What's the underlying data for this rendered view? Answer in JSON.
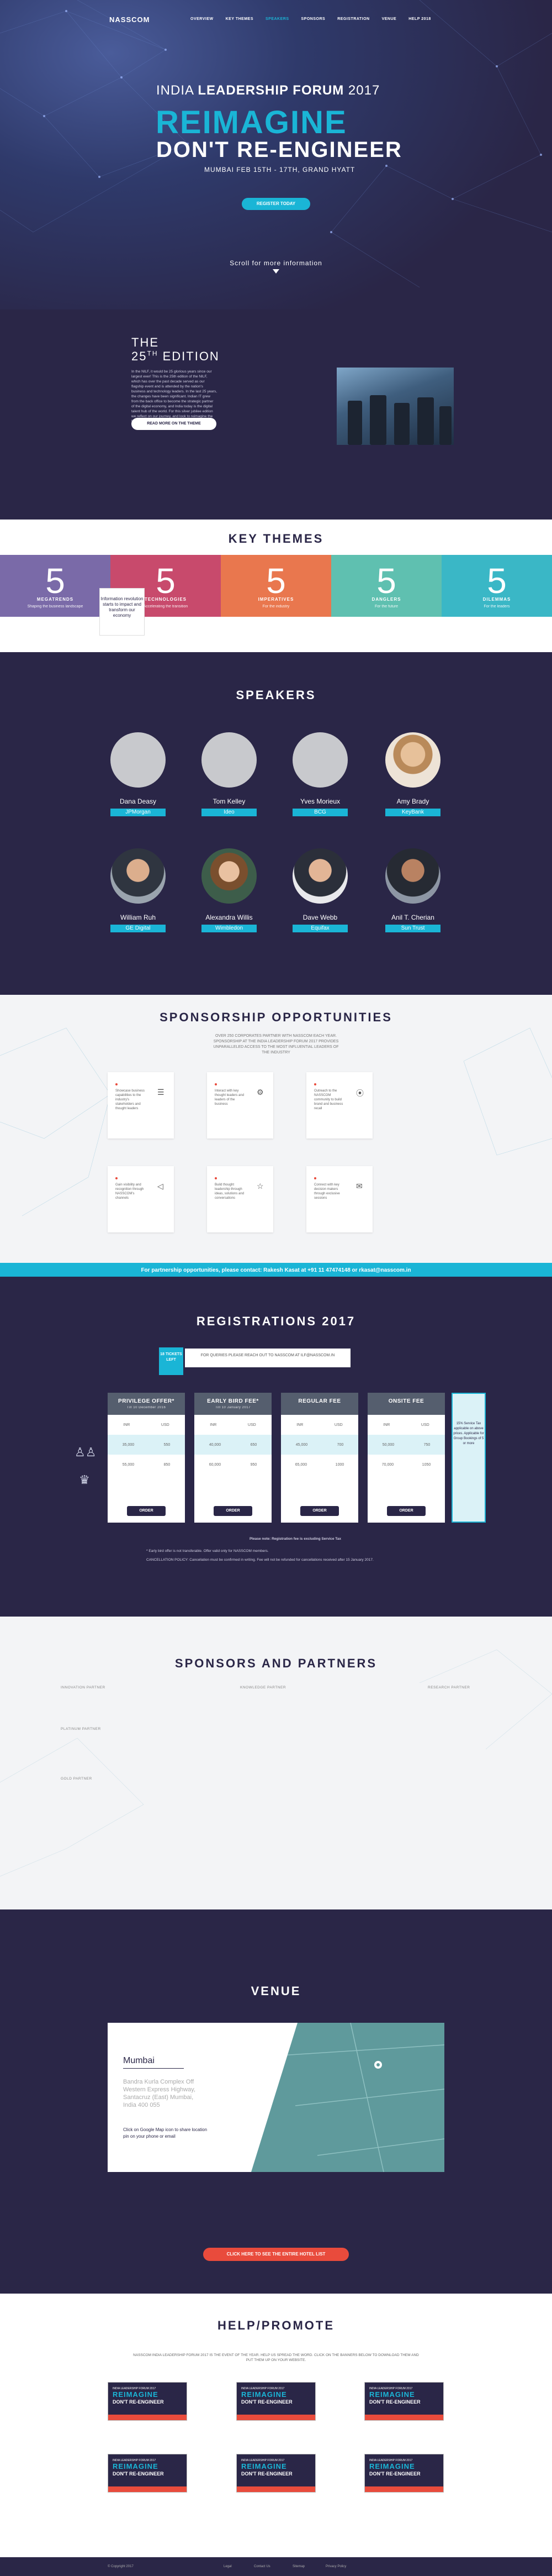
{
  "nav": {
    "logo": "NASSCOM",
    "items": [
      "OVERVIEW",
      "KEY THEMES",
      "SPEAKERS",
      "SPONSORS",
      "REGISTRATION",
      "VENUE",
      "HELP 2018"
    ]
  },
  "hero": {
    "forum_light": "INDIA ",
    "forum_bold": "LEADERSHIP FORUM",
    "forum_year": " 2017",
    "line1": "REIMAGINE",
    "line2": "DON'T RE-ENGINEER",
    "date": "MUMBAI FEB 15TH - 17TH, GRAND HYATT",
    "cta": "REGISTER TODAY",
    "scroll": "Scroll for more information"
  },
  "edition": {
    "the": "THE",
    "title": "25",
    "title_sup": "TH",
    "title_rest": " EDITION",
    "body": "In the NILF, it would be 25 glorious years since our largest ever! This is the 25th edition of the NILF, which has over the past decade served as our flagship event and is attended by the nation's business and technology leaders. In the last 25 years, the changes have been significant. Indian IT grew from the back office to become the strategic partner of the digital economy, and India today is the digital talent hub of the world. For this silver jubilee edition we reflect on our journey, and look to reimagine the future.",
    "cta": "READ MORE ON THE THEME"
  },
  "themes": {
    "title": "KEY THEMES",
    "items": [
      {
        "n": "5",
        "t": "MEGATRENDS",
        "s": "Shaping the business landscape",
        "color": "#7a6aa8"
      },
      {
        "n": "5",
        "t": "TECHNOLOGIES",
        "s": "Accelerating the transition",
        "color": "#c84a6c"
      },
      {
        "n": "5",
        "t": "IMPERATIVES",
        "s": "For the industry",
        "color": "#e9774e"
      },
      {
        "n": "5",
        "t": "DANGLERS",
        "s": "For the future",
        "color": "#5fc0b0"
      },
      {
        "n": "5",
        "t": "DILEMMAS",
        "s": "For the leaders",
        "color": "#3ab7c6"
      }
    ],
    "tooltip": "Information revolution starts to impact and transform our economy"
  },
  "speakers": {
    "title": "SPEAKERS",
    "items": [
      {
        "name": "Dana Deasy",
        "company": "JPMorgan",
        "photo": false
      },
      {
        "name": "Tom Kelley",
        "company": "Ideo",
        "photo": false
      },
      {
        "name": "Yves Morieux",
        "company": "BCG",
        "photo": false
      },
      {
        "name": "Amy Brady",
        "company": "KeyBank",
        "photo": true
      },
      {
        "name": "William Ruh",
        "company": "GE Digital",
        "photo": true
      },
      {
        "name": "Alexandra Willis",
        "company": "Wimbledon",
        "photo": true
      },
      {
        "name": "Dave Webb",
        "company": "Equifax",
        "photo": true
      },
      {
        "name": "Anil T. Cherian",
        "company": "Sun Trust",
        "photo": true
      }
    ]
  },
  "sponsorship": {
    "title": "SPONSORSHIP OPPORTUNITIES",
    "sub": "OVER 250 CORPORATES PARTNER WITH NASSCOM EACH YEAR. SPONSORSHIP AT THE INDIA LEADERSHIP FORUM 2017 PROVIDES UNPARALLELED ACCESS TO THE MOST INFLUENTIAL LEADERS OF THE INDUSTRY",
    "cards": [
      {
        "text": "Showcase business capabilities to the industry's stakeholders and thought leaders",
        "icon": "☰"
      },
      {
        "text": "Interact with key thought leaders and leaders of the business",
        "icon": "⚙"
      },
      {
        "text": "Outreach to the NASSCOM community to build brand and business recall",
        "icon": "⦿"
      },
      {
        "text": "Gain visibility and recognition through NASSCOM's channels",
        "icon": "◁"
      },
      {
        "text": "Build thought leadership through ideas, solutions and conversations",
        "icon": "☆"
      },
      {
        "text": "Connect with key decision makers through exclusive sessions",
        "icon": "✉"
      }
    ],
    "bar": "For partnership opportunities, please contact: Rakesh Kasat at +91 11 47474148 or rkasat@nasscom.in"
  },
  "registrations": {
    "title": "REGISTRATIONS 2017",
    "flag": "18 TICKETS LEFT",
    "note": "FOR QUERIES PLEASE REACH OUT TO NASSCOM AT ILF@NASSCOM.IN",
    "cols": [
      {
        "name": "PRIVILEGE OFFER*",
        "sub": "Till 10 December 2016",
        "r1": [
          "INR",
          "USD"
        ],
        "r2": [
          "35,000",
          "550"
        ],
        "r3": [
          "55,000",
          "850"
        ]
      },
      {
        "name": "EARLY BIRD FEE*",
        "sub": "Till 10 January 2017",
        "r1": [
          "INR",
          "USD"
        ],
        "r2": [
          "40,000",
          "650"
        ],
        "r3": [
          "60,000",
          "950"
        ]
      },
      {
        "name": "REGULAR FEE",
        "sub": "",
        "r1": [
          "INR",
          "USD"
        ],
        "r2": [
          "45,000",
          "700"
        ],
        "r3": [
          "65,000",
          "1000"
        ]
      },
      {
        "name": "ONSITE FEE",
        "sub": "",
        "r1": [
          "INR",
          "USD"
        ],
        "r2": [
          "50,000",
          "750"
        ],
        "r3": [
          "70,000",
          "1050"
        ]
      }
    ],
    "order": "ORDER",
    "gst": "15% Service Tax applicable on above prices. Applicable for Group Bookings of 5 or more",
    "fine1": "Please note: Registration fee is excluding Service Tax",
    "fine2": "* Early bird offer is not transferable. Offer valid only for NASSCOM members.",
    "fine3": "CANCELLATION POLICY: Cancellation must be confirmed in writing. Fee will not be refunded for cancellations received after 15 January 2017."
  },
  "partners": {
    "title": "SPONSORS AND PARTNERS",
    "labels": [
      "INNOVATION PARTNER",
      "KNOWLEDGE PARTNER",
      "RESEARCH PARTNER",
      "PLATINUM PARTNER",
      "GOLD PARTNER",
      "STRATEGIC PARTNER"
    ]
  },
  "venue": {
    "title": "VENUE",
    "city": "Mumbai",
    "addr": "Bandra Kurla Complex Off Western Express Highway, Santacruz (East) Mumbai, India 400 055",
    "link": "Click on Google Map icon to share location pin on your phone or email",
    "cta": "CLICK HERE TO SEE THE ENTIRE HOTEL LIST"
  },
  "help": {
    "title": "HELP/PROMOTE",
    "sub": "NASSCOM INDIA LEADERSHIP FORUM 2017 IS THE EVENT OF THE YEAR. HELP US SPREAD THE WORD. CLICK ON THE BANNERS BELOW TO DOWNLOAD THEM AND PUT THEM UP ON YOUR WEBSITE.",
    "banner_line": "INDIA LEADERSHIP FORUM 2017",
    "banner_t": "REIMAGINE",
    "banner_s": "DON'T RE-ENGINEER",
    "footer_left": "© Copyright 2017",
    "footer_links": [
      "Legal",
      "Contact Us",
      "Sitemap",
      "Privacy Policy"
    ]
  }
}
